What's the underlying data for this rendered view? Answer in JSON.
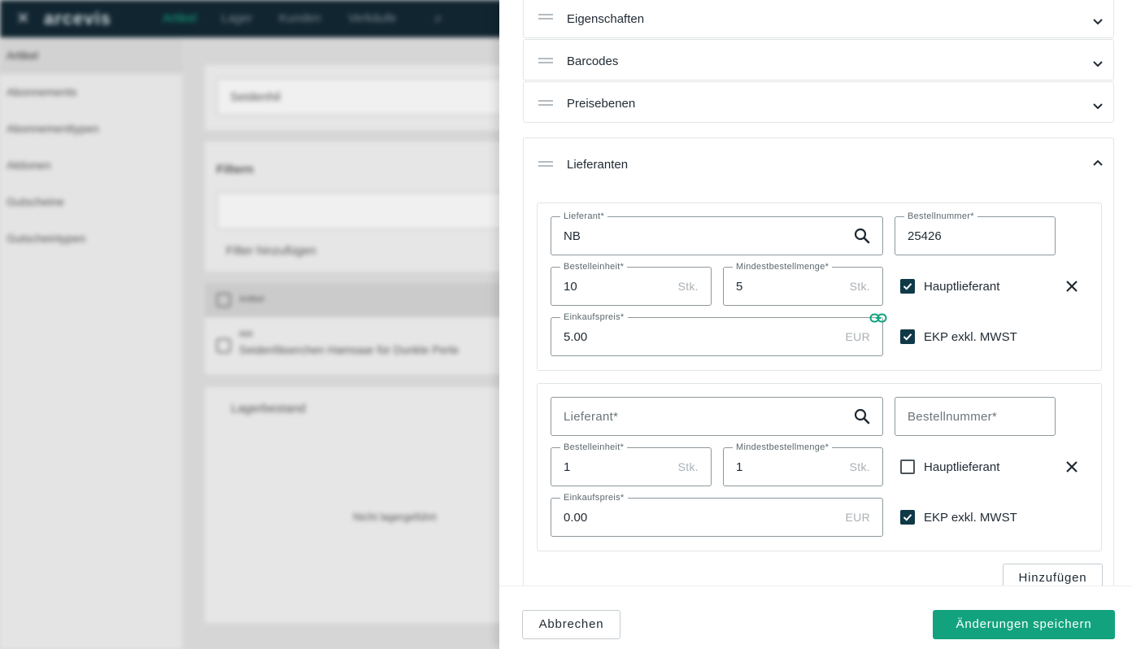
{
  "app": {
    "logo": "arcevis",
    "nav": [
      "Artikel",
      "Lager",
      "Kunden",
      "Verkäufe"
    ],
    "sidebar": [
      "Artikel",
      "Abonnements",
      "Abonnementtypen",
      "Aktionen",
      "Gutscheine",
      "Gutscheintypen"
    ],
    "search_placeholder": "Seidenhil",
    "filter_heading": "Filtern",
    "add_filter": "Filter hinzufügen",
    "column_header": "Artikel",
    "row_code": "888",
    "row_name": "Seidenfäserchen Hamsaar für Dunkle Perle",
    "stock_heading": "Lagerbestand",
    "stock_empty": "Nicht lagergeführt"
  },
  "panel": {
    "sections": [
      {
        "title": "Eigenschaften"
      },
      {
        "title": "Barcodes"
      },
      {
        "title": "Preisebenen"
      },
      {
        "title": "Lieferanten"
      }
    ],
    "suppliers": [
      {
        "supplier_label": "Lieferant*",
        "supplier_value": "NB",
        "order_number_label": "Bestellnummer*",
        "order_number_value": "25426",
        "order_unit_label": "Bestelleinheit*",
        "order_unit_value": "10",
        "order_unit_suffix": "Stk.",
        "min_order_label": "Mindestbestellmenge*",
        "min_order_value": "5",
        "min_order_suffix": "Stk.",
        "main_supplier_label": "Hauptlieferant",
        "main_supplier_checked": true,
        "purchase_price_label": "Einkaufspreis*",
        "purchase_price_value": "5.00",
        "currency": "EUR",
        "ekp_label": "EKP exkl. MWST",
        "ekp_checked": true
      },
      {
        "supplier_placeholder": "Lieferant*",
        "order_number_placeholder": "Bestellnummer*",
        "order_unit_label": "Bestelleinheit*",
        "order_unit_value": "1",
        "order_unit_suffix": "Stk.",
        "min_order_label": "Mindestbestellmenge*",
        "min_order_value": "1",
        "min_order_suffix": "Stk.",
        "main_supplier_label": "Hauptlieferant",
        "main_supplier_checked": false,
        "purchase_price_label": "Einkaufspreis*",
        "purchase_price_value": "0.00",
        "currency": "EUR",
        "ekp_label": "EKP exkl. MWST",
        "ekp_checked": true
      }
    ],
    "add_label": "Hinzufügen",
    "cancel_label": "Abbrechen",
    "save_label": "Änderungen speichern"
  },
  "colors": {
    "accent": "#12a37e",
    "checkbox": "#0f3947",
    "topbar": "#102530"
  },
  "icons": [
    "search-icon",
    "drag-handle-icon",
    "chevron-down-icon",
    "chevron-up-icon",
    "close-icon",
    "link-icon",
    "checkmark-icon"
  ]
}
